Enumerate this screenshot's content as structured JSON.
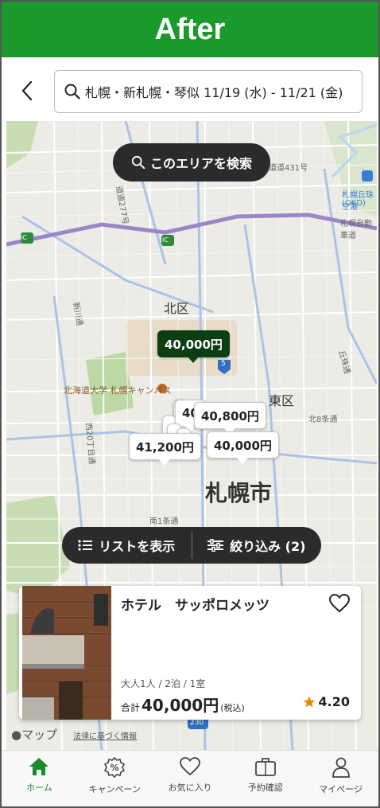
{
  "banner": {
    "title": "After"
  },
  "header": {
    "search_text": "札幌・新札幌・琴似 11/19 (水) - 11/21 (金)"
  },
  "map": {
    "area_search_label": "このエリアを検索",
    "labels": {
      "kita_ku": "北区",
      "higashi_ku": "東区",
      "sapporo_shi": "札幌市",
      "hokudai": "北海道大学 札幌キャンパス",
      "airport": "札幌丘珠空港",
      "airport_code": "(OKD)",
      "expressway": "札幌自動車道",
      "route5": "5",
      "route230": "230",
      "ic": "IC",
      "road_431": "道道431号",
      "road_277": "道道277号",
      "shinkawa": "新川通",
      "nishi20": "西20丁目通",
      "minami1": "南1条通",
      "kita8": "北8条通",
      "oka": "丘珠通"
    },
    "pins": [
      {
        "label": "40,000円",
        "selected": true
      },
      {
        "label": "40,800円",
        "selected": false
      },
      {
        "label": "40",
        "selected": false
      },
      {
        "label": "41,200円",
        "selected": false
      },
      {
        "label": "40,000円",
        "selected": false
      }
    ],
    "list_button": "リストを表示",
    "filter_button": "絞り込み (2)"
  },
  "card": {
    "hotel_name": "ホテル　サッポロメッツ",
    "guests": "大人1人 / 2泊 / 1室",
    "total_label": "合計",
    "price": "40,000円",
    "tax": "(税込)",
    "rating": "4.20"
  },
  "map_footer": {
    "apple_maps": "マップ",
    "legal": "法律に基づく情報"
  },
  "tabs": [
    {
      "label": "ホーム",
      "icon": "home-icon",
      "active": true
    },
    {
      "label": "キャンペーン",
      "icon": "percent-badge-icon",
      "active": false
    },
    {
      "label": "お気に入り",
      "icon": "heart-icon",
      "active": false
    },
    {
      "label": "予約確認",
      "icon": "suitcase-icon",
      "active": false
    },
    {
      "label": "マイページ",
      "icon": "person-icon",
      "active": false
    }
  ],
  "colors": {
    "brand_green": "#1a9a2c",
    "selected_pin": "#0d3d12",
    "star": "#e08a00"
  }
}
